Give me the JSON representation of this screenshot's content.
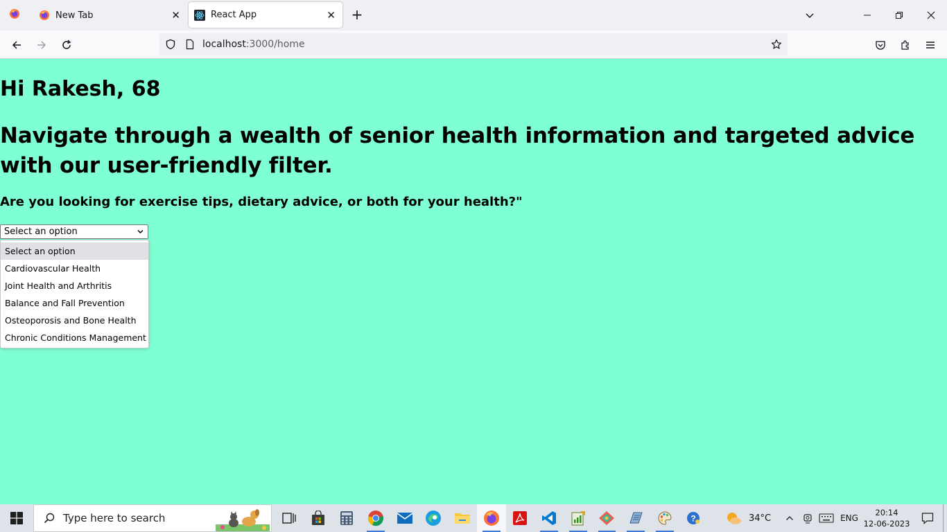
{
  "browser": {
    "tabs": [
      {
        "title": "New Tab",
        "active": false
      },
      {
        "title": "React App",
        "active": true
      }
    ],
    "url_host": "localhost",
    "url_path": ":3000/home"
  },
  "page": {
    "greeting": "Hi Rakesh, 68",
    "headline": "Navigate through a wealth of senior health information and targeted advice with our user-friendly filter.",
    "question": "Are you looking for exercise tips, dietary advice, or both for your health?\"",
    "select_value": "Select an option",
    "options": [
      "Select an option",
      "Cardiovascular Health",
      "Joint Health and Arthritis",
      "Balance and Fall Prevention",
      "Osteoporosis and Bone Health",
      "Chronic Conditions Management"
    ],
    "background_color": "#7fffd4"
  },
  "taskbar": {
    "search_placeholder": "Type here to search",
    "weather": "34°C",
    "language": "ENG",
    "time": "20:14",
    "date": "12-06-2023"
  }
}
